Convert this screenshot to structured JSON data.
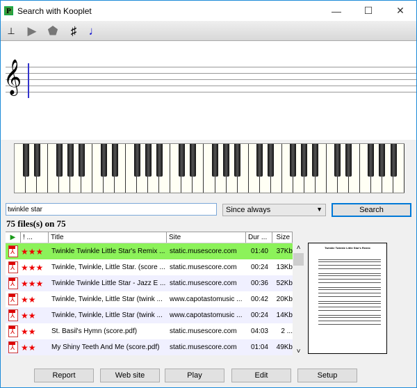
{
  "window": {
    "title": "Search with Kooplet",
    "app_icon_letter": "P"
  },
  "toolbar": {
    "items": [
      "staff-icon",
      "play-icon",
      "stop-icon",
      "sharp-icon",
      "note-icon"
    ]
  },
  "search": {
    "value": "twinkle star",
    "date_filter": "Since always",
    "search_label": "Search"
  },
  "results": {
    "count_label": "75 files(s) on 75",
    "columns": [
      "",
      "! ...",
      "Title",
      "Site",
      "Dur ...",
      "Size"
    ],
    "rows": [
      {
        "rating": "★★★",
        "title": "Twinkle Twinkle Little Star's Remix  ...",
        "site": "static.musescore.com",
        "duration": "01:40",
        "size": "37Kb",
        "selected": true
      },
      {
        "rating": "★★★",
        "title": "Twinkle, Twinkle, Little Star. (score ...",
        "site": "static.musescore.com",
        "duration": "00:24",
        "size": "13Kb"
      },
      {
        "rating": "★★★",
        "title": "Twinkle Twinkle Little Star - Jazz E ...",
        "site": "static.musescore.com",
        "duration": "00:36",
        "size": "52Kb"
      },
      {
        "rating": "★★",
        "title": "Twinkle, Twinkle, Little Star (twink ...",
        "site": "www.capotastomusic ...",
        "duration": "00:42",
        "size": "20Kb"
      },
      {
        "rating": "★★",
        "title": "Twinkle, Twinkle, Little Star (twink ...",
        "site": "www.capotastomusic ...",
        "duration": "00:24",
        "size": "14Kb"
      },
      {
        "rating": "★★",
        "title": "St. Basil's Hymn (score.pdf)",
        "site": "static.musescore.com",
        "duration": "04:03",
        "size": "2 ..."
      },
      {
        "rating": "★★",
        "title": "My Shiny Teeth And Me (score.pdf)",
        "site": "static.musescore.com",
        "duration": "01:04",
        "size": "49Kb"
      }
    ]
  },
  "preview": {
    "title": "Twinkle Twinkle Little Star's Remix"
  },
  "buttons": {
    "report": "Report",
    "website": "Web site",
    "play": "Play",
    "edit": "Edit",
    "setup": "Setup"
  },
  "colors": {
    "selected_row": "#8cf25a",
    "stars": "#e00000",
    "cursor": "#3333cc"
  }
}
